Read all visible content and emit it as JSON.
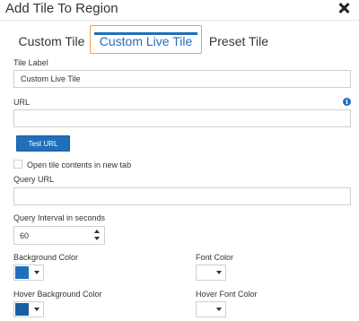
{
  "dialog": {
    "title": "Add Tile To Region",
    "close_icon": "close-icon"
  },
  "tabs": [
    {
      "label": "Custom Tile",
      "selected": false
    },
    {
      "label": "Custom Live Tile",
      "selected": true
    },
    {
      "label": "Preset Tile",
      "selected": false
    }
  ],
  "form": {
    "tile_label": {
      "label": "Tile Label",
      "value": "Custom Live Tile"
    },
    "url": {
      "label": "URL",
      "value": "",
      "info_icon": "info-icon",
      "info_glyph": "i"
    },
    "test_button": "Test URL",
    "open_new_tab": {
      "label": "Open tile contents in new tab",
      "checked": false
    },
    "query_url": {
      "label": "Query URL",
      "value": ""
    },
    "query_interval": {
      "label": "Query Interval in seconds",
      "value": "60"
    },
    "background_color": {
      "label": "Background Color",
      "color": "#1f6fbd"
    },
    "font_color": {
      "label": "Font Color",
      "color": "#ffffff"
    },
    "hover_background_color": {
      "label": "Hover Background Color",
      "color": "#1a5fa2"
    },
    "hover_font_color": {
      "label": "Hover Font Color",
      "color": "#ffffff"
    }
  },
  "colors": {
    "accent": "#1f6fbd",
    "tab_highlight_border": "#f0a44a"
  }
}
